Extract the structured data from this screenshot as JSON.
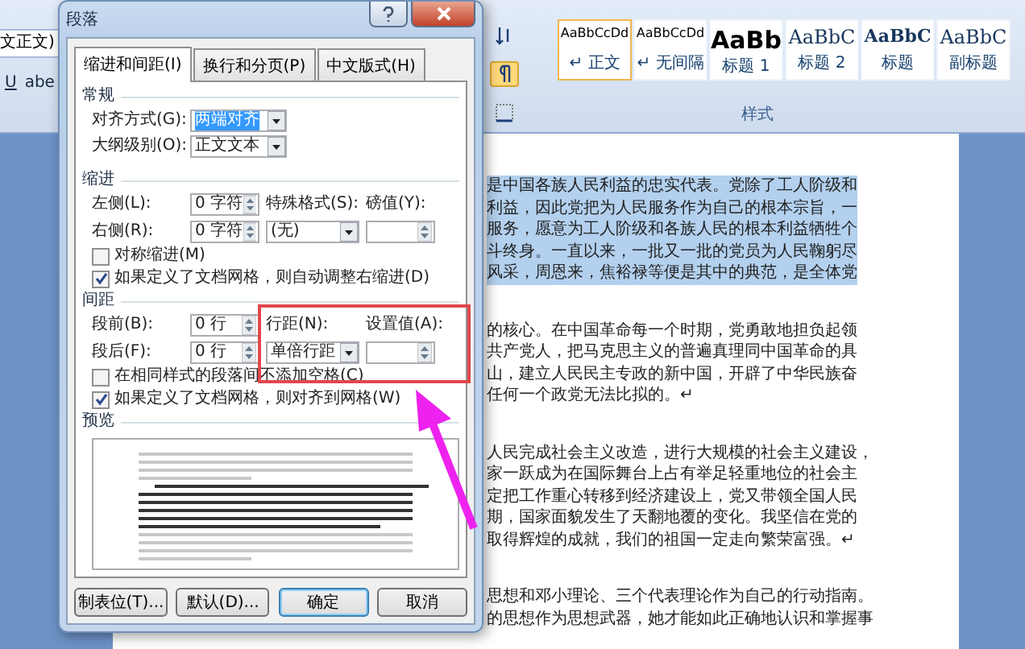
{
  "ribbon": {
    "font_field": "文正文)",
    "format_buttons": [
      "U",
      "abe"
    ],
    "styles": [
      {
        "preview": "AaBbCcDd",
        "name": "↵ 正文",
        "kind": "plain",
        "selected": true
      },
      {
        "preview": "AaBbCcDd",
        "name": "↵ 无间隔",
        "kind": "plain",
        "selected": false
      },
      {
        "preview": "AaBb",
        "name": "标题 1",
        "kind": "heading",
        "selected": false
      },
      {
        "preview": "AaBbC",
        "name": "标题 2",
        "kind": "serif",
        "selected": false
      },
      {
        "preview": "AaBbC",
        "name": "标题",
        "kind": "serif-bold",
        "selected": false
      },
      {
        "preview": "AaBbC",
        "name": "副标题",
        "kind": "serif",
        "selected": false
      }
    ],
    "group_label": "样式"
  },
  "document": {
    "paragraphs": [
      {
        "selected": true,
        "lines": [
          "是中国各族人民利益的忠实代表。党除了工人阶级和",
          "利益，因此党把为人民服务作为自己的根本宗旨，一",
          "服务，愿意为工人阶级和各族人民的根本利益牺牲个",
          "斗终身。一直以来，一批又一批的党员为人民鞠躬尽",
          "风采，周恩来，焦裕禄等便是其中的典范，是全体党"
        ]
      },
      {
        "selected": false,
        "lines": [
          "的核心。在中国革命每一个时期，党勇敢地担负起领",
          "共产党人，把马克思主义的普遍真理同中国革命的具",
          "山，建立人民民主专政的新中国，开辟了中华民族奋",
          "任何一个政党无法比拟的。↵"
        ]
      },
      {
        "selected": false,
        "lines": [
          "人民完成社会主义改造，进行大规模的社会主义建设，",
          "家一跃成为在国际舞台上占有举足轻重地位的社会主",
          "定把工作重心转移到经济建设上，党又带领全国人民",
          "期，国家面貌发生了天翻地覆的变化。我坚信在党的",
          "取得辉煌的成就，我们的祖国一定走向繁荣富强。↵"
        ]
      },
      {
        "selected": false,
        "lines": [
          "思想和邓小理论、三个代表理论作为自己的行动指南。",
          "的思想作为思想武器，她才能如此正确地认识和掌握事"
        ]
      }
    ]
  },
  "dialog": {
    "title": "段落",
    "tabs": [
      {
        "label": "缩进和间距(I)",
        "selected": true
      },
      {
        "label": "换行和分页(P)",
        "selected": false
      },
      {
        "label": "中文版式(H)",
        "selected": false
      }
    ],
    "general": {
      "heading": "常规",
      "alignment": {
        "label": "对齐方式(G):",
        "value": "两端对齐",
        "highlighted": true
      },
      "outline": {
        "label": "大纲级别(O):",
        "value": "正文文本",
        "highlighted": false
      }
    },
    "indent": {
      "heading": "缩进",
      "left": {
        "label": "左侧(L):",
        "value": "0 字符"
      },
      "right": {
        "label": "右侧(R):",
        "value": "0 字符"
      },
      "special": {
        "label": "特殊格式(S):",
        "value": "(无)",
        "highlighted": false
      },
      "by": {
        "label": "磅值(Y):"
      },
      "checkboxes": [
        {
          "label": "对称缩进(M)",
          "checked": false
        },
        {
          "label": "如果定义了文档网格，则自动调整右缩进(D)",
          "checked": true
        }
      ]
    },
    "spacing": {
      "heading": "间距",
      "before": {
        "label": "段前(B):",
        "value": "0 行"
      },
      "after": {
        "label": "段后(F):",
        "value": "0 行"
      },
      "line_spacing": {
        "label": "行距(N):",
        "value": "单倍行距",
        "highlighted": false
      },
      "at": {
        "label": "设置值(A):"
      },
      "checkboxes": [
        {
          "label": "在相同样式的段落间不添加空格(C)",
          "checked": false
        },
        {
          "label": "如果定义了文档网格，则对齐到网格(W)",
          "checked": true
        }
      ]
    },
    "preview": {
      "heading": "预览"
    },
    "buttons": [
      {
        "label": "制表位(T)...",
        "default": false
      },
      {
        "label": "默认(D)...",
        "default": false
      },
      {
        "label": "确定",
        "default": true
      },
      {
        "label": "取消",
        "default": false
      }
    ]
  }
}
